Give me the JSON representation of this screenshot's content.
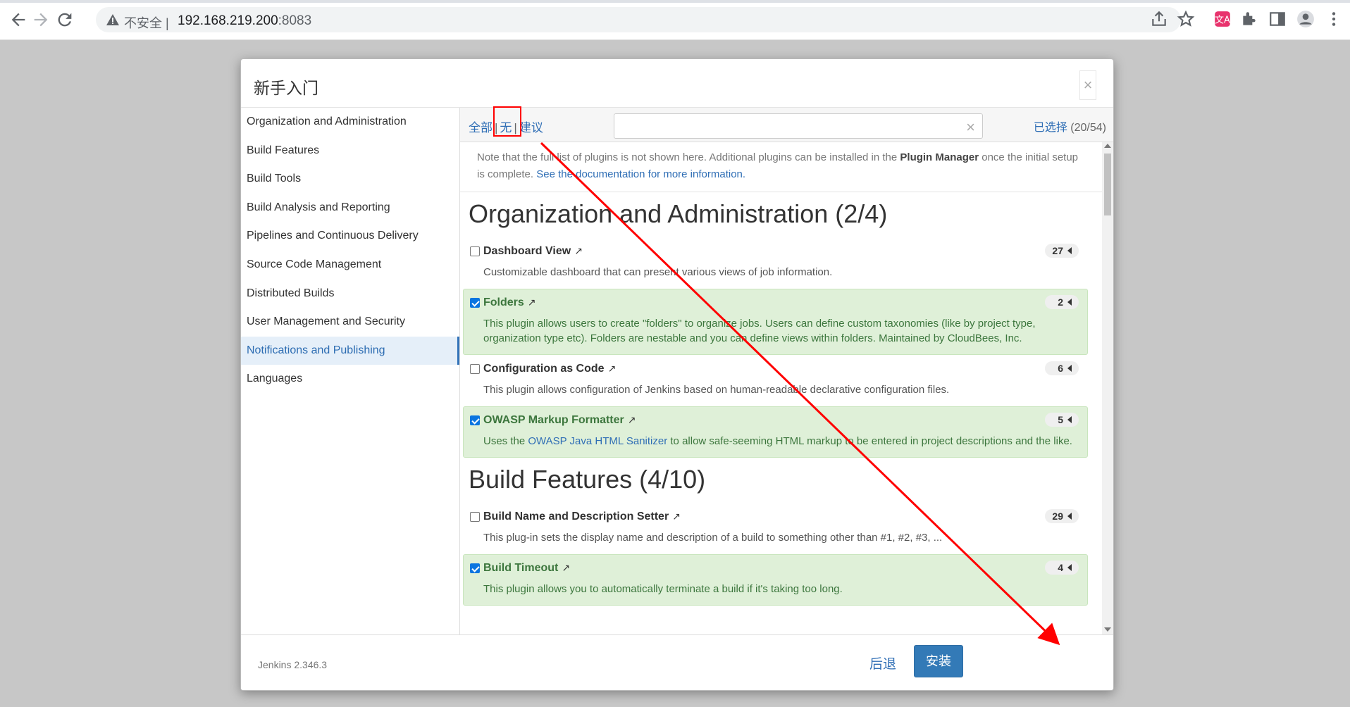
{
  "browser": {
    "insecure_label": "不安全 |",
    "url_host": "192.168.219.200",
    "url_port": ":8083"
  },
  "dialog": {
    "title": "新手入门",
    "close_symbol": "×"
  },
  "sidebar": {
    "items": [
      {
        "label": "Organization and Administration"
      },
      {
        "label": "Build Features"
      },
      {
        "label": "Build Tools"
      },
      {
        "label": "Build Analysis and Reporting"
      },
      {
        "label": "Pipelines and Continuous Delivery"
      },
      {
        "label": "Source Code Management"
      },
      {
        "label": "Distributed Builds"
      },
      {
        "label": "User Management and Security"
      },
      {
        "label": "Notifications and Publishing"
      },
      {
        "label": "Languages"
      }
    ],
    "active_index": 8
  },
  "filters": {
    "all": "全部",
    "none": "无",
    "suggested": "建议",
    "separator": "|",
    "clear_symbol": "×",
    "selected_label": "已选择",
    "selected_count": "(20/54)"
  },
  "note": {
    "part1": "Note that the full list of plugins is not shown here. Additional plugins can be installed in the",
    "plugin_manager": "Plugin Manager",
    "part2": "once the initial setup is complete.",
    "doc_link": "See the documentation for more information."
  },
  "categories": [
    {
      "title": "Organization and Administration (2/4)",
      "plugins": [
        {
          "name": "Dashboard View",
          "ext": "↗",
          "deps": "27",
          "selected": false,
          "desc": "Customizable dashboard that can present various views of job information."
        },
        {
          "name": "Folders",
          "ext": "↗",
          "deps": "2",
          "selected": true,
          "desc": "This plugin allows users to create \"folders\" to organize jobs. Users can define custom taxonomies (like by project type, organization type etc). Folders are nestable and you can define views within folders. Maintained by CloudBees, Inc."
        },
        {
          "name": "Configuration as Code",
          "ext": "↗",
          "deps": "6",
          "selected": false,
          "desc": "This plugin allows configuration of Jenkins based on human-readable declarative configuration files."
        },
        {
          "name": "OWASP Markup Formatter",
          "ext": "↗",
          "deps": "5",
          "selected": true,
          "desc_pre": "Uses the",
          "desc_link": "OWASP Java HTML Sanitizer",
          "desc_post": "to allow safe-seeming HTML markup to be entered in project descriptions and the like."
        }
      ]
    },
    {
      "title": "Build Features (4/10)",
      "plugins": [
        {
          "name": "Build Name and Description Setter",
          "ext": "↗",
          "deps": "29",
          "selected": false,
          "desc": "This plug-in sets the display name and description of a build to something other than #1, #2, #3, ..."
        },
        {
          "name": "Build Timeout",
          "ext": "↗",
          "deps": "4",
          "selected": true,
          "desc": "This plugin allows you to automatically terminate a build if it's taking too long."
        }
      ]
    }
  ],
  "footer": {
    "version": "Jenkins 2.346.3",
    "back": "后退",
    "install": "安装"
  },
  "colors": {
    "accent": "#337ab7",
    "selected_bg": "#dff0d8",
    "annotation": "#ff0000"
  }
}
